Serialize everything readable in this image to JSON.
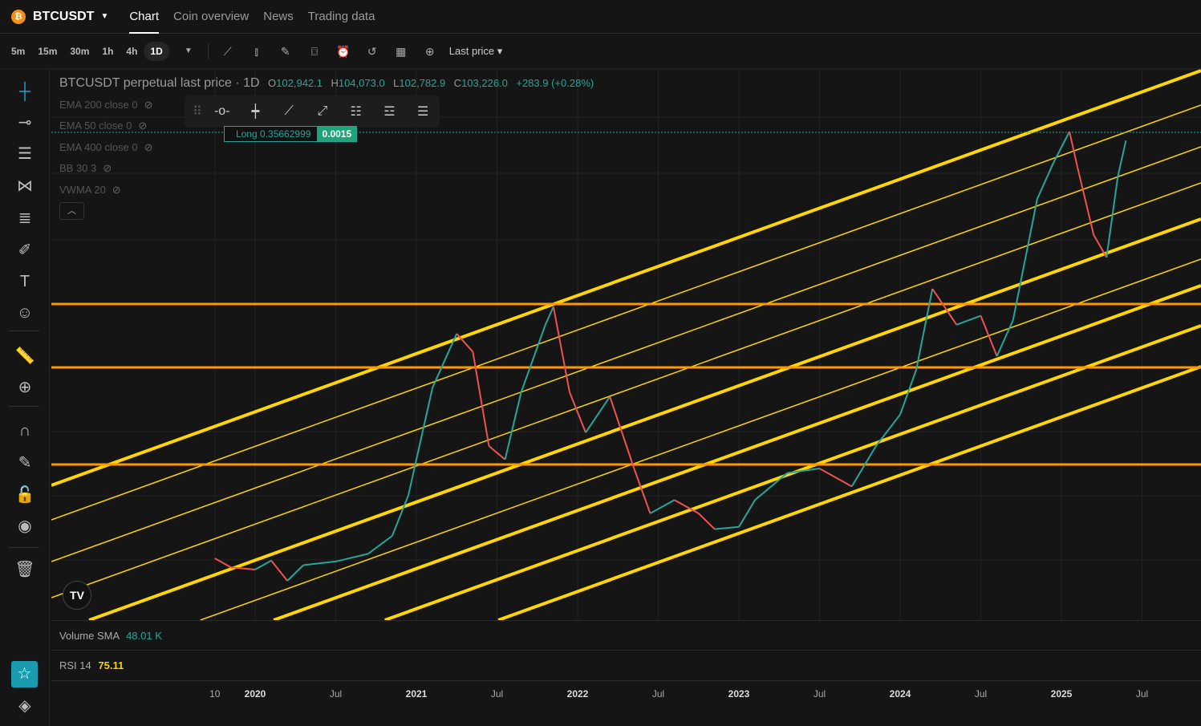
{
  "header": {
    "symbol": "BTCUSDT",
    "coin_icon": "bitcoin-icon",
    "tabs": [
      "Chart",
      "Coin overview",
      "News",
      "Trading data"
    ],
    "active_tab": "Chart"
  },
  "toolbar": {
    "timeframes": [
      "5m",
      "15m",
      "30m",
      "1h",
      "4h",
      "1D"
    ],
    "active_timeframe": "1D",
    "price_type": "Last price"
  },
  "legend": {
    "title": "BTCUSDT perpetual last price · 1D",
    "o_label": "O",
    "o": "102,942.1",
    "h_label": "H",
    "h": "104,073.0",
    "l_label": "L",
    "l": "102,782.9",
    "c_label": "C",
    "c": "103,226.0",
    "change": "+283.9 (+0.28%)"
  },
  "indicators": [
    "EMA 200 close 0",
    "EMA 50 close 0",
    "EMA 400 close 0",
    "BB 30 3",
    "VWMA 20"
  ],
  "position": {
    "label": "Long 0.35662999",
    "qty": "0.0015"
  },
  "volume": {
    "label": "Volume SMA",
    "value": "48.01 K"
  },
  "rsi": {
    "label": "RSI 14",
    "value": "75.11"
  },
  "logo": "TV",
  "colors": {
    "up": "#26a69a",
    "down": "#ef5350",
    "channel": "#ffd600",
    "level": "#ff9800",
    "rsi": "#f5d300"
  },
  "chart_data": {
    "type": "line",
    "x_ticks": [
      "10",
      "2020",
      "Jul",
      "2021",
      "Jul",
      "2022",
      "Jul",
      "2023",
      "Jul",
      "2024",
      "Jul",
      "2025",
      "Jul"
    ],
    "x_tick_years": [
      2019.75,
      2020,
      2020.5,
      2021,
      2021.5,
      2022,
      2022.5,
      2023,
      2023.5,
      2024,
      2024.5,
      2025,
      2025.5
    ],
    "price_k": [
      [
        2019.75,
        10
      ],
      [
        2019.85,
        8
      ],
      [
        2020.0,
        7.5
      ],
      [
        2020.1,
        9.5
      ],
      [
        2020.2,
        5
      ],
      [
        2020.3,
        8.5
      ],
      [
        2020.5,
        9.3
      ],
      [
        2020.7,
        11
      ],
      [
        2020.85,
        15
      ],
      [
        2020.95,
        24
      ],
      [
        2021.1,
        48
      ],
      [
        2021.25,
        60
      ],
      [
        2021.35,
        56
      ],
      [
        2021.45,
        35
      ],
      [
        2021.55,
        32
      ],
      [
        2021.65,
        47
      ],
      [
        2021.8,
        62
      ],
      [
        2021.85,
        66
      ],
      [
        2021.95,
        47
      ],
      [
        2022.05,
        38
      ],
      [
        2022.2,
        46
      ],
      [
        2022.35,
        30
      ],
      [
        2022.45,
        20
      ],
      [
        2022.6,
        23
      ],
      [
        2022.75,
        20
      ],
      [
        2022.85,
        16.5
      ],
      [
        2023.0,
        17
      ],
      [
        2023.1,
        23
      ],
      [
        2023.3,
        29
      ],
      [
        2023.5,
        30
      ],
      [
        2023.7,
        26
      ],
      [
        2023.85,
        35
      ],
      [
        2024.0,
        42
      ],
      [
        2024.1,
        52
      ],
      [
        2024.2,
        70
      ],
      [
        2024.35,
        62
      ],
      [
        2024.5,
        64
      ],
      [
        2024.6,
        55
      ],
      [
        2024.7,
        63
      ],
      [
        2024.85,
        90
      ],
      [
        2024.95,
        98
      ],
      [
        2025.05,
        105
      ],
      [
        2025.1,
        97
      ],
      [
        2025.2,
        82
      ],
      [
        2025.28,
        77
      ],
      [
        2025.35,
        95
      ],
      [
        2025.4,
        103
      ]
    ]
  }
}
